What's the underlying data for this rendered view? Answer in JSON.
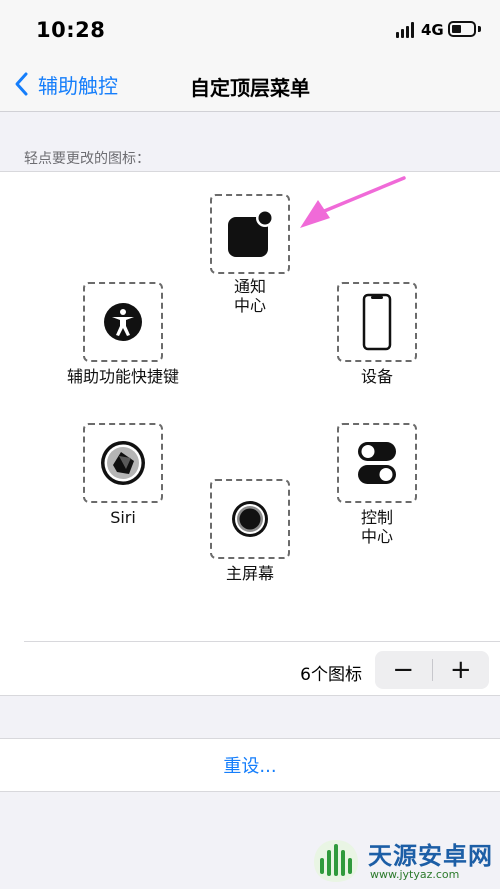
{
  "status_bar": {
    "time": "10:28",
    "network": "4G"
  },
  "nav": {
    "back_label": "辅助触控",
    "title": "自定顶层菜单"
  },
  "editor": {
    "hint": "轻点要更改的图标：",
    "slots": [
      {
        "label": "通知\n中心",
        "icon": "notification-center-icon"
      },
      {
        "label": "辅助功能快捷键",
        "icon": "accessibility-icon"
      },
      {
        "label": "设备",
        "icon": "device-icon"
      },
      {
        "label": "Siri",
        "icon": "siri-icon"
      },
      {
        "label": "控制\n中心",
        "icon": "control-center-icon"
      },
      {
        "label": "主屏幕",
        "icon": "home-button-icon"
      }
    ],
    "count_label": "6个图标",
    "minus_label": "−",
    "plus_label": "+"
  },
  "reset_label": "重设...",
  "watermark": {
    "name": "天源安卓网",
    "url": "www.jytyaz.com"
  },
  "colors": {
    "accent": "#157efb",
    "arrow": "#f06ad8",
    "background": "#f2f2f7"
  }
}
